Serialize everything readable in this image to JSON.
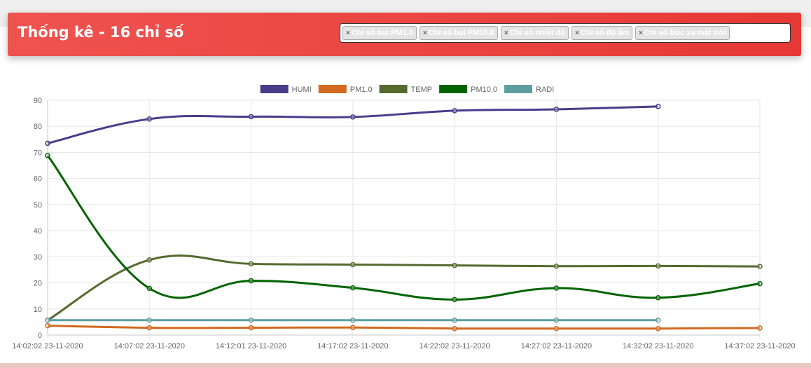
{
  "header": {
    "title": "Thống kê - 16 chỉ số",
    "tags": [
      "Chỉ số bụi PM1.0",
      "Chỉ số bụi PM10.0",
      "Chỉ số nhiệt độ",
      "Chỉ số độ ẩm",
      "Chỉ số bức xạ mặt trời"
    ],
    "remove_symbol": "×"
  },
  "chart_data": {
    "type": "line",
    "categories": [
      "14:02:02 23-11-2020",
      "14:07:02 23-11-2020",
      "14:12:01 23-11-2020",
      "14:17:02 23-11-2020",
      "14:22:02 23-11-2020",
      "14:27:02 23-11-2020",
      "14:32:02 23-11-2020",
      "14:37:02 23-11-2020"
    ],
    "ylim": [
      0,
      90
    ],
    "yticks": [
      0,
      10,
      20,
      30,
      40,
      50,
      60,
      70,
      80,
      90
    ],
    "grid": true,
    "legend_position": "top",
    "series": [
      {
        "name": "HUMI",
        "color": "#483D8B",
        "values": [
          73.5,
          82.8,
          83.7,
          83.6,
          86.0,
          86.5,
          87.6,
          null
        ]
      },
      {
        "name": "PM1.0",
        "color": "#D2691E",
        "values": [
          3.6,
          2.8,
          2.8,
          2.9,
          2.5,
          2.5,
          2.5,
          2.7
        ]
      },
      {
        "name": "TEMP",
        "color": "#556B2F",
        "values": [
          5.7,
          28.8,
          27.3,
          27.0,
          26.7,
          26.4,
          26.5,
          26.3
        ]
      },
      {
        "name": "PM10.0",
        "color": "#006400",
        "values": [
          68.8,
          17.9,
          20.8,
          18.1,
          13.6,
          18.0,
          14.3,
          19.7
        ]
      },
      {
        "name": "RADI",
        "color": "#5F9EA0",
        "values": [
          5.7,
          5.7,
          5.7,
          5.7,
          5.7,
          5.7,
          5.7,
          null
        ]
      }
    ]
  }
}
